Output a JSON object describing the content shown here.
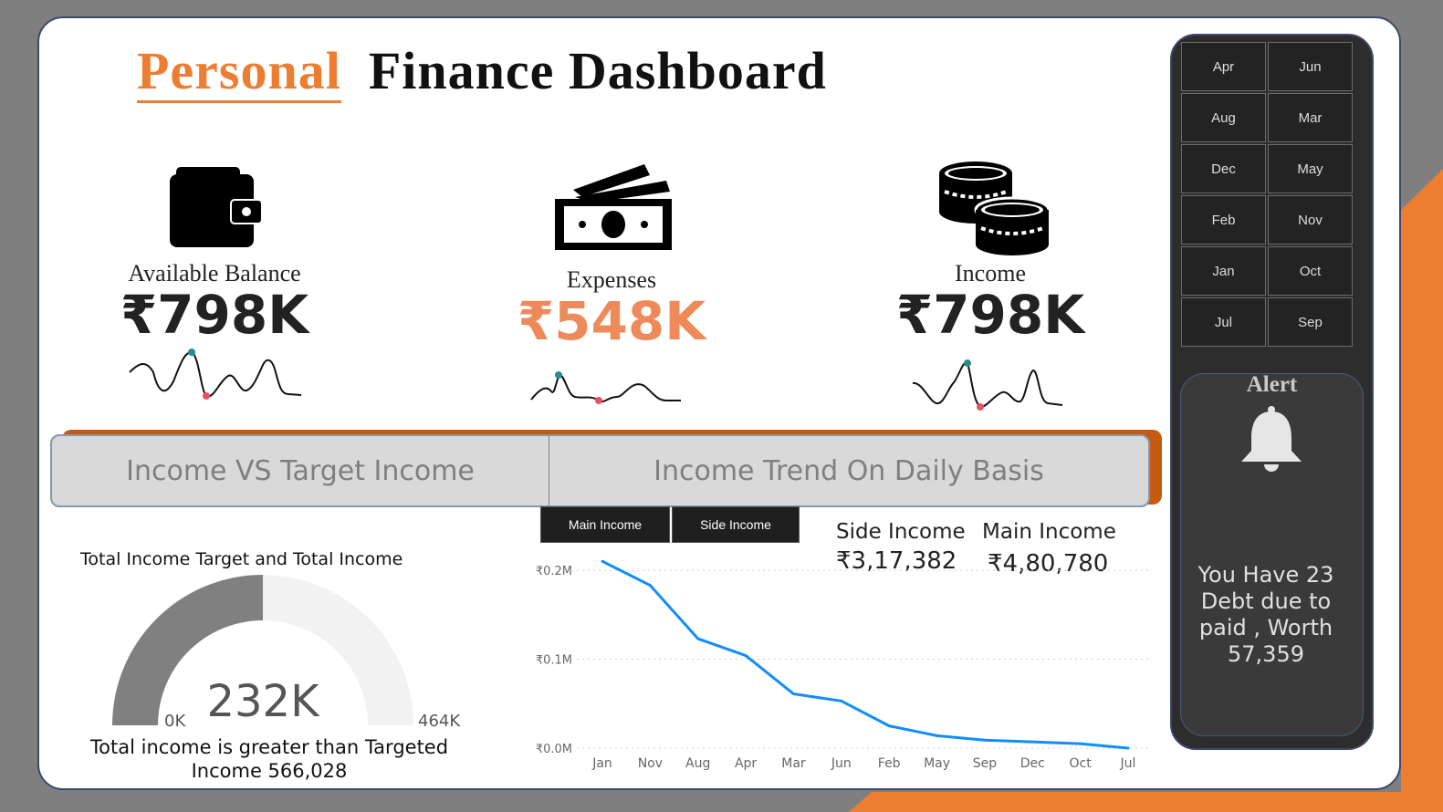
{
  "header": {
    "title_accent": "Personal",
    "title_main": "Finance Dashboard"
  },
  "kpis": {
    "balance": {
      "label": "Available Balance",
      "value": "₹798K",
      "icon": "wallet-icon"
    },
    "expenses": {
      "label": "Expenses",
      "value": "₹548K",
      "icon": "money-bills-icon"
    },
    "income": {
      "label": "Income",
      "value": "₹798K",
      "icon": "coins-icon"
    }
  },
  "tabs": {
    "left": "Income VS Target Income",
    "right": "Income  Trend On Daily Basis"
  },
  "buttons": {
    "main": "Main Income",
    "side": "Side Income"
  },
  "stats": {
    "side_label": "Side Income",
    "side_value": "₹3,17,382",
    "main_label": "Main  Income",
    "main_value": "₹4,80,780"
  },
  "gauge": {
    "title": "Total Income Target and Total Income",
    "value": "232K",
    "min": "0K",
    "max": "464K",
    "value_num": 232,
    "max_num": 464,
    "note": "Total income is greater than Targeted Income 566,028"
  },
  "chart_data": {
    "type": "line",
    "categories": [
      "Jan",
      "Nov",
      "Aug",
      "Apr",
      "Mar",
      "Jun",
      "Feb",
      "May",
      "Sep",
      "Dec",
      "Oct",
      "Jul"
    ],
    "values": [
      0.21,
      0.183,
      0.123,
      0.104,
      0.061,
      0.053,
      0.025,
      0.014,
      0.009,
      0.007,
      0.005,
      0.0
    ],
    "ylim": [
      0,
      0.2
    ],
    "yticks": [
      "₹0.0M",
      "₹0.1M",
      "₹0.2M"
    ],
    "ytick_values": [
      0,
      0.1,
      0.2
    ],
    "color": "#118dff",
    "grid": true
  },
  "months_slicer": [
    "Apr",
    "Jun",
    "Aug",
    "Mar",
    "Dec",
    "May",
    "Feb",
    "Nov",
    "Jan",
    "Oct",
    "Jul",
    "Sep"
  ],
  "alert": {
    "title": "Alert",
    "message": "You Have 23 Debt due to paid , Worth 57,359",
    "icon": "bell-icon"
  },
  "colors": {
    "accent": "#ed7d31",
    "panel": "#2d2d2d",
    "line": "#118dff"
  }
}
